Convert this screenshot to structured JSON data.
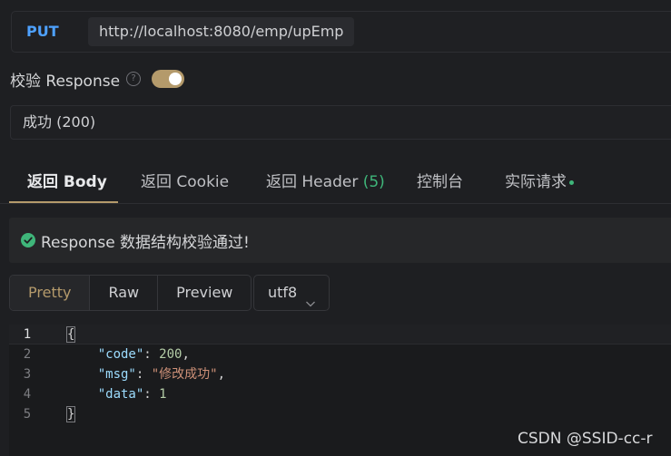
{
  "request": {
    "method": "PUT",
    "url": "http://localhost:8080/emp/upEmp"
  },
  "validate": {
    "label": "校验 Response",
    "help": "?",
    "enabled": true
  },
  "status_select": {
    "value": "成功 (200)"
  },
  "tabs": [
    {
      "label": "返回 Body",
      "active": true
    },
    {
      "label": "返回 Cookie"
    },
    {
      "label": "返回 Header",
      "count": "(5)"
    },
    {
      "label": "控制台"
    },
    {
      "label": "实际请求"
    }
  ],
  "validation_message": "Response 数据结构校验通过!",
  "view_modes": [
    "Pretty",
    "Raw",
    "Preview"
  ],
  "active_view": "Pretty",
  "encoding": "utf8",
  "code": {
    "line_numbers": [
      "1",
      "2",
      "3",
      "4",
      "5"
    ],
    "open_brace": "{",
    "close_brace": "}",
    "lines": [
      {
        "key": "\"code\"",
        "value": "200",
        "comma": ","
      },
      {
        "key": "\"msg\"",
        "value": "\"修改成功\"",
        "comma": ","
      },
      {
        "key": "\"data\"",
        "value": "1",
        "comma": ""
      }
    ]
  },
  "watermark": "CSDN @SSID-cc-r",
  "colors": {
    "accent": "#b49a6b",
    "method": "#4ea1ff",
    "success": "#3fb67a"
  }
}
